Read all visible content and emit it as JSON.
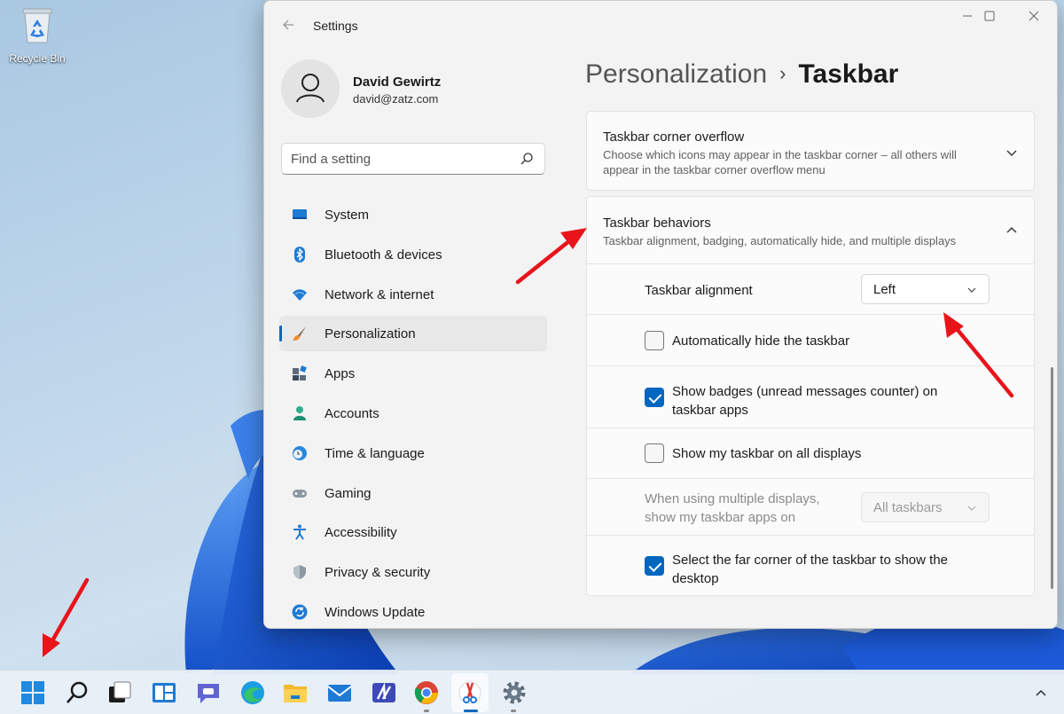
{
  "desktop": {
    "recycle_bin_label": "Recycle Bin"
  },
  "window": {
    "title": "Settings",
    "controls": {
      "minimize": "—",
      "maximize": "☐",
      "close": "✕"
    }
  },
  "profile": {
    "name": "David Gewirtz",
    "email": "david@zatz.com"
  },
  "search": {
    "placeholder": "Find a setting"
  },
  "nav": {
    "items": [
      {
        "label": "System",
        "icon": "system-icon"
      },
      {
        "label": "Bluetooth & devices",
        "icon": "bluetooth-icon"
      },
      {
        "label": "Network & internet",
        "icon": "network-icon"
      },
      {
        "label": "Personalization",
        "icon": "brush-icon",
        "active": true
      },
      {
        "label": "Apps",
        "icon": "apps-icon"
      },
      {
        "label": "Accounts",
        "icon": "accounts-icon"
      },
      {
        "label": "Time & language",
        "icon": "globe-clock-icon"
      },
      {
        "label": "Gaming",
        "icon": "gamepad-icon"
      },
      {
        "label": "Accessibility",
        "icon": "accessibility-icon"
      },
      {
        "label": "Privacy & security",
        "icon": "shield-icon"
      },
      {
        "label": "Windows Update",
        "icon": "update-icon"
      }
    ]
  },
  "breadcrumb": {
    "parent": "Personalization",
    "separator": "›",
    "current": "Taskbar"
  },
  "sections": {
    "corner_overflow": {
      "title": "Taskbar corner overflow",
      "description": "Choose which icons may appear in the taskbar corner – all others will appear in the taskbar corner overflow menu"
    },
    "behaviors": {
      "title": "Taskbar behaviors",
      "description": "Taskbar alignment, badging, automatically hide, and multiple displays",
      "alignment": {
        "label": "Taskbar alignment",
        "value": "Left"
      },
      "auto_hide": {
        "label": "Automatically hide the taskbar",
        "checked": false
      },
      "badges": {
        "label": "Show badges (unread messages counter) on taskbar apps",
        "checked": true
      },
      "all_displays": {
        "label": "Show my taskbar on all displays",
        "checked": false
      },
      "multi_display": {
        "label": "When using multiple displays, show my taskbar apps on",
        "value": "All taskbars",
        "disabled": true
      },
      "far_corner": {
        "label": "Select the far corner of the taskbar to show the desktop",
        "checked": true
      }
    }
  },
  "colors": {
    "accent": "#0067c0",
    "annotation": "#e8141a"
  },
  "taskbar": {
    "icons": [
      "start-icon",
      "search-icon",
      "task-view-icon",
      "widgets-icon",
      "chat-icon",
      "edge-icon",
      "file-explorer-icon",
      "mail-icon",
      "app-icon",
      "chrome-icon",
      "snipping-tool-icon",
      "settings-icon"
    ]
  }
}
